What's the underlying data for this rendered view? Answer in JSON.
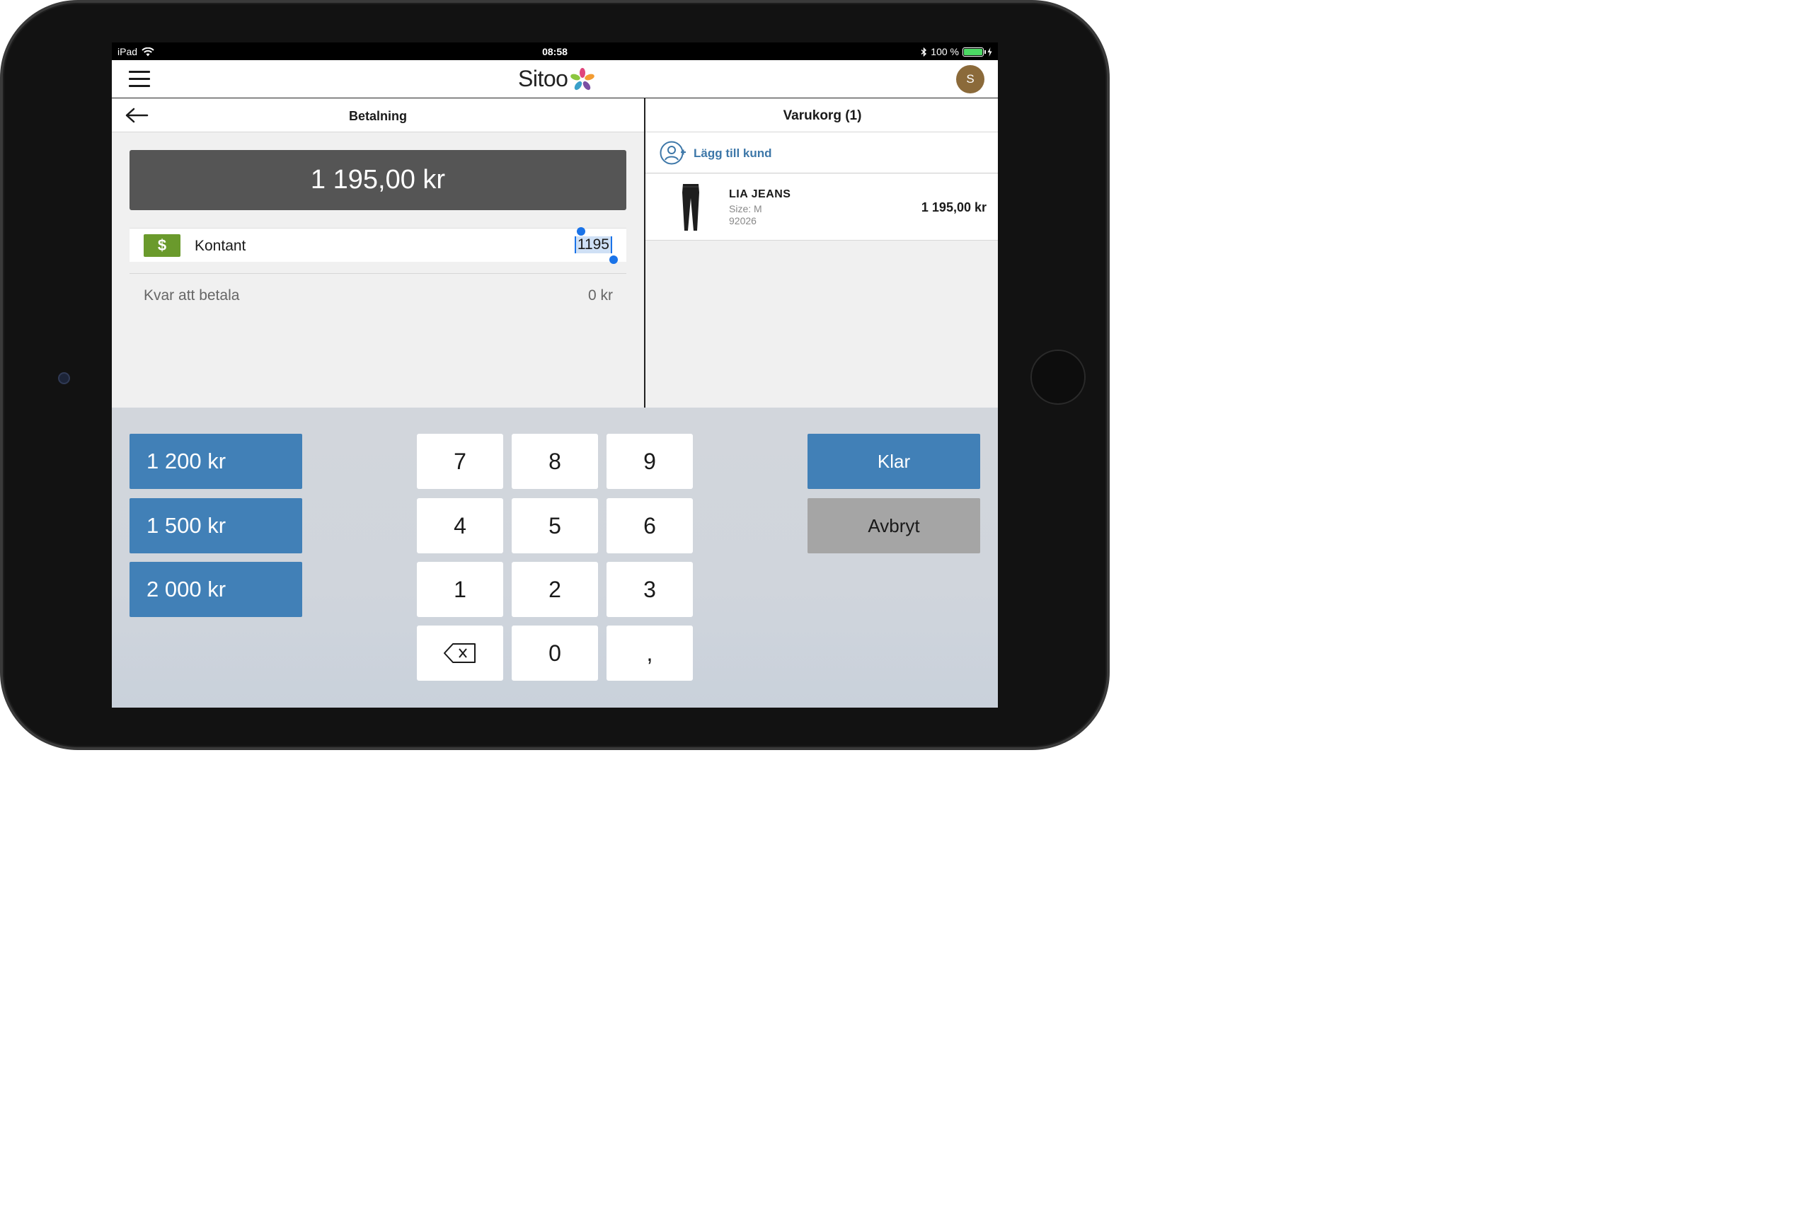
{
  "statusbar": {
    "device": "iPad",
    "time": "08:58",
    "battery": "100 %",
    "battery_level": 1.0,
    "icons": [
      "wifi-icon",
      "bluetooth-icon",
      "battery-icon",
      "charging-icon"
    ]
  },
  "appbar": {
    "logo_text": "Sitoo",
    "avatar_initial": "S",
    "avatar_color": "#8b6a3a"
  },
  "payment": {
    "title": "Betalning",
    "total": "1 195,00 kr",
    "method_label": "Kontant",
    "method_icon_text": "$",
    "method_color": "#6a9a2c",
    "input_value": "1195",
    "remaining_label": "Kvar att betala",
    "remaining_value": "0 kr"
  },
  "cart": {
    "title": "Varukorg (1)",
    "add_customer_label": "Lägg till kund",
    "items": [
      {
        "name": "LIA JEANS",
        "size": "Size: M",
        "sku": "92026",
        "price": "1 195,00 kr"
      }
    ]
  },
  "keypad": {
    "quick_amounts": [
      "1 200 kr",
      "1 500 kr",
      "2 000 kr"
    ],
    "keys": [
      "7",
      "8",
      "9",
      "4",
      "5",
      "6",
      "1",
      "2",
      "3",
      "⌫",
      "0",
      ","
    ],
    "done_label": "Klar",
    "cancel_label": "Avbryt",
    "accent_color": "#4180b7"
  }
}
